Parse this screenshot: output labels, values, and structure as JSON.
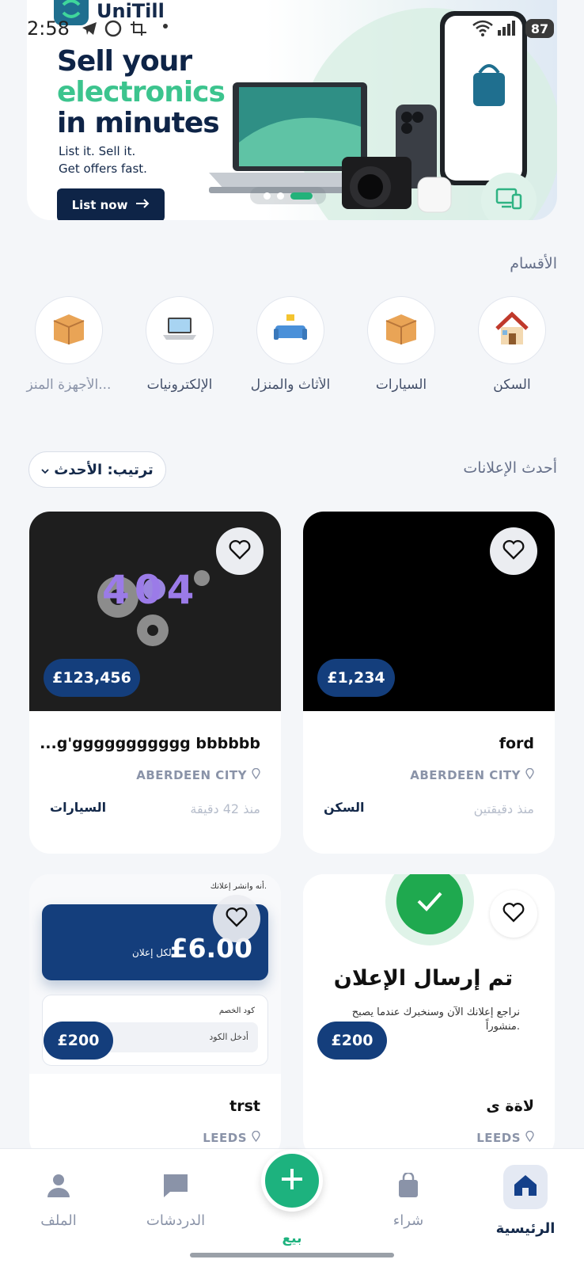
{
  "status_bar": {
    "time": "2:58",
    "battery": "87"
  },
  "banner": {
    "brand": "UniTill",
    "headline_line1": "Sell your",
    "headline_line2": "electronics",
    "headline_line3": "in minutes",
    "sub_line1": "List it. Sell it.",
    "sub_line2": "Get offers fast.",
    "cta": "List now",
    "slides_count": 3,
    "active_slide": 3
  },
  "categories": {
    "title": "الأقسام",
    "items": [
      {
        "label": "السكن",
        "icon": "house-icon"
      },
      {
        "label": "السيارات",
        "icon": "box-icon"
      },
      {
        "label": "الأثاث والمنزل",
        "icon": "sofa-icon"
      },
      {
        "label": "الإلكترونيات",
        "icon": "laptop-icon"
      },
      {
        "label": "الأجهزة المنز...",
        "icon": "box-icon"
      }
    ]
  },
  "listings": {
    "title": "أحدث الإعلانات",
    "sort_label": "ترتيب: الأحدث",
    "cards": [
      {
        "price": "£1,234",
        "title": "ford",
        "location": "ABERDEEN CITY",
        "time": "منذ دقيقتين",
        "category": "السكن"
      },
      {
        "price": "£123,456",
        "title": "...g'ggggggggggg bbbbbb",
        "location": "ABERDEEN CITY",
        "time": "منذ 42 دقيقة",
        "category": "السيارات",
        "image_text": "404"
      },
      {
        "price": "£200",
        "title": "لاةة ى",
        "location": "LEEDS",
        "image_heading": "تم إرسال الإعلان",
        "image_sub": "نراجع إعلانك الآن وسنخبرك عندما يصبح منشوراً."
      },
      {
        "price": "£200",
        "title": "trst",
        "location": "LEEDS",
        "image_top": "أنه وانشر إعلانك.",
        "image_price": "£6.00",
        "image_per": "لكل إعلان",
        "image_code_label": "كود الخصم",
        "image_code_placeholder": "أدخل الكود"
      }
    ]
  },
  "bottom_nav": {
    "home": "الرئيسية",
    "buy": "شراء",
    "sell": "بيع",
    "chats": "الدردشات",
    "profile": "الملف"
  },
  "colors": {
    "primary": "#143e7c",
    "accent": "#1db27e",
    "navy": "#0e2447"
  }
}
